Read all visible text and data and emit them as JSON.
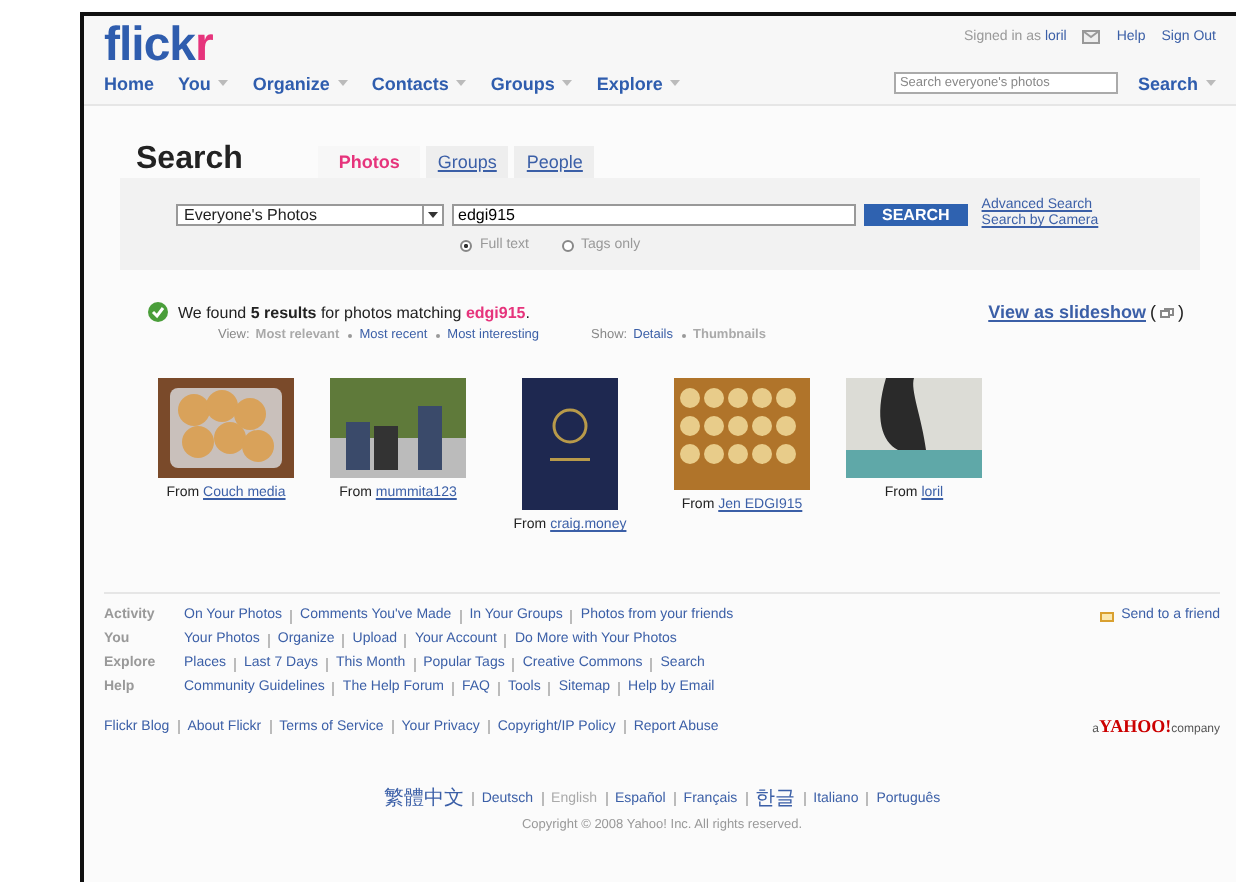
{
  "header": {
    "logo_main": "flick",
    "logo_accent": "r",
    "signed_in_label": "Signed in as",
    "user": "loril",
    "help": "Help",
    "sign_out": "Sign Out",
    "nav": [
      {
        "label": "Home",
        "has_menu": false
      },
      {
        "label": "You",
        "has_menu": true
      },
      {
        "label": "Organize",
        "has_menu": true
      },
      {
        "label": "Contacts",
        "has_menu": true
      },
      {
        "label": "Groups",
        "has_menu": true
      },
      {
        "label": "Explore",
        "has_menu": true
      }
    ],
    "search_placeholder": "Search everyone's photos",
    "search_button": "Search"
  },
  "search": {
    "title": "Search",
    "tabs": [
      {
        "label": "Photos",
        "selected": true
      },
      {
        "label": "Groups",
        "selected": false
      },
      {
        "label": "People",
        "selected": false
      }
    ],
    "scope": "Everyone's Photos",
    "query": "edgi915",
    "button": "SEARCH",
    "links": [
      "Advanced Search",
      "Search by Camera"
    ],
    "modes": [
      {
        "label": "Full text",
        "selected": true
      },
      {
        "label": "Tags only",
        "selected": false
      }
    ]
  },
  "results": {
    "summary": "We found **5 results** for photos matching ",
    "term": "edgi915",
    "summary_end": ".",
    "view_label": "View:",
    "view_options": [
      {
        "label": "Most relevant",
        "selected": true
      },
      {
        "label": "Most recent",
        "selected": false
      },
      {
        "label": "Most interesting",
        "selected": false
      }
    ],
    "show_label": "Show:",
    "show_options": [
      {
        "label": "Details",
        "selected": false
      },
      {
        "label": "Thumbnails",
        "selected": true
      }
    ],
    "slideshow": "View as slideshow",
    "paren_open": "(",
    "paren_close": ")",
    "photos": [
      {
        "kind": "food",
        "from": "From",
        "owner": "Couch media"
      },
      {
        "kind": "people",
        "from": "From",
        "owner": "mummita123"
      },
      {
        "kind": "passport",
        "from": "From",
        "owner": "craig.money"
      },
      {
        "kind": "bees",
        "from": "From",
        "owner": "Jen EDGI915"
      },
      {
        "kind": "cave",
        "from": "From",
        "owner": "loril"
      }
    ]
  },
  "footer": {
    "sections": [
      {
        "label": "Activity",
        "links": [
          "On Your Photos",
          "Comments You've Made",
          "In Your Groups",
          "Photos from your friends"
        ]
      },
      {
        "label": "You",
        "links": [
          "Your Photos",
          "Organize",
          "Upload",
          "Your Account",
          "Do More with Your Photos"
        ]
      },
      {
        "label": "Explore",
        "links": [
          "Places",
          "Last 7 Days",
          "This Month",
          "Popular Tags",
          "Creative Commons",
          "Search"
        ]
      },
      {
        "label": "Help",
        "links": [
          "Community Guidelines",
          "The Help Forum",
          "FAQ",
          "Tools",
          "Sitemap",
          "Help by Email"
        ]
      }
    ],
    "send_to_friend": "Send to a friend",
    "bottom_links": [
      "Flickr Blog",
      "About Flickr",
      "Terms of Service",
      "Your Privacy",
      "Copyright/IP Policy",
      "Report Abuse"
    ],
    "yahoo_pre": "a",
    "yahoo": "YAHOO!",
    "yahoo_post": "company",
    "languages": [
      {
        "label": "繁體中文",
        "selected": false
      },
      {
        "label": "Deutsch",
        "selected": false
      },
      {
        "label": "English",
        "selected": true
      },
      {
        "label": "Español",
        "selected": false
      },
      {
        "label": "Français",
        "selected": false
      },
      {
        "label": "한글",
        "selected": false
      },
      {
        "label": "Italiano",
        "selected": false
      },
      {
        "label": "Português",
        "selected": false
      }
    ],
    "copyright": "Copyright © 2008 Yahoo! Inc. All rights reserved."
  }
}
